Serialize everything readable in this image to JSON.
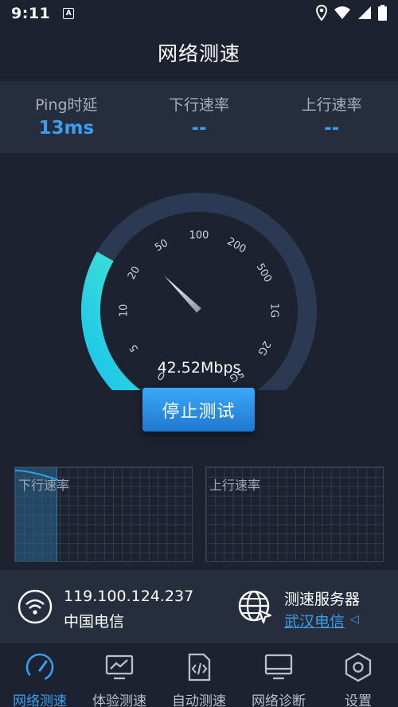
{
  "status_bar": {
    "time": "9:11",
    "a_icon": "A"
  },
  "header": {
    "title": "网络测速"
  },
  "metrics": [
    {
      "label": "Ping时延",
      "value": "13ms"
    },
    {
      "label": "下行速率",
      "value": "--"
    },
    {
      "label": "上行速率",
      "value": "--"
    }
  ],
  "gauge": {
    "ticks": [
      "0",
      "5",
      "10",
      "20",
      "50",
      "100",
      "200",
      "500",
      "1G",
      "2G",
      "5G"
    ],
    "progress_fraction": 0.3,
    "needle_fraction": 0.35,
    "speed": "42.52Mbps"
  },
  "actions": {
    "stop_label": "停止测试"
  },
  "graphs": {
    "down_label": "下行速率",
    "up_label": "上行速率",
    "down_fill_fraction": 0.24
  },
  "network": {
    "ip": "119.100.124.237",
    "isp": "中国电信",
    "server_label": "测速服务器",
    "server_name": "武汉电信"
  },
  "nav": [
    {
      "label": "网络测速",
      "icon": "speedometer-icon",
      "active": true
    },
    {
      "label": "体验测速",
      "icon": "monitor-chart-icon",
      "active": false
    },
    {
      "label": "自动测速",
      "icon": "code-file-icon",
      "active": false
    },
    {
      "label": "网络诊断",
      "icon": "desktop-icon",
      "active": false
    },
    {
      "label": "设置",
      "icon": "hexagon-settings-icon",
      "active": false
    }
  ],
  "colors": {
    "accent": "#3a9ff0",
    "gauge_progress_start": "#16c2ee",
    "gauge_progress_end": "#3ee0d4",
    "gauge_track": "#2b3952"
  }
}
